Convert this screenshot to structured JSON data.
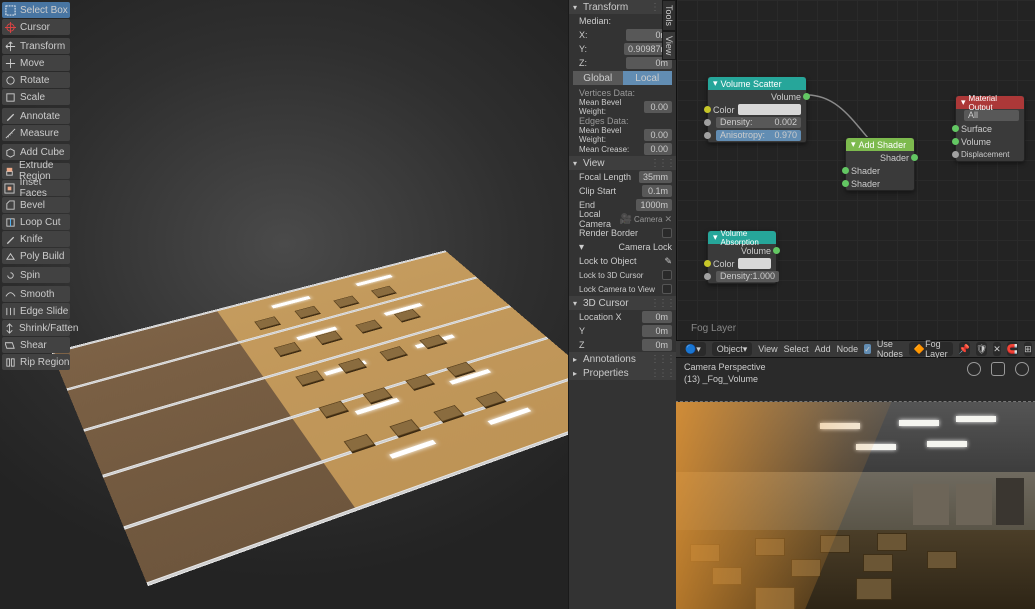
{
  "toolbox": {
    "groups": [
      [
        {
          "name": "select-box",
          "label": "Select Box",
          "selected": true
        },
        {
          "name": "cursor",
          "label": "Cursor"
        }
      ],
      [
        {
          "name": "transform",
          "label": "Transform"
        },
        {
          "name": "move",
          "label": "Move"
        },
        {
          "name": "rotate",
          "label": "Rotate"
        },
        {
          "name": "scale",
          "label": "Scale"
        }
      ],
      [
        {
          "name": "annotate",
          "label": "Annotate"
        },
        {
          "name": "measure",
          "label": "Measure"
        }
      ],
      [
        {
          "name": "add-cube",
          "label": "Add Cube"
        }
      ],
      [
        {
          "name": "extrude-region",
          "label": "Extrude Region"
        },
        {
          "name": "inset-faces",
          "label": "Inset Faces"
        },
        {
          "name": "bevel",
          "label": "Bevel"
        },
        {
          "name": "loop-cut",
          "label": "Loop Cut"
        },
        {
          "name": "knife",
          "label": "Knife"
        },
        {
          "name": "poly-build",
          "label": "Poly Build"
        }
      ],
      [
        {
          "name": "spin",
          "label": "Spin"
        }
      ],
      [
        {
          "name": "smooth",
          "label": "Smooth"
        },
        {
          "name": "edge-slide",
          "label": "Edge Slide"
        },
        {
          "name": "shrink-fatten",
          "label": "Shrink/Fatten"
        },
        {
          "name": "shear",
          "label": "Shear"
        },
        {
          "name": "rip-region",
          "label": "Rip Region"
        }
      ]
    ]
  },
  "npanel": {
    "transform": {
      "title": "Transform",
      "median_label": "Median:",
      "x_label": "X:",
      "x_value": "0m",
      "y_label": "Y:",
      "y_value": "0.90987m",
      "z_label": "Z:",
      "z_value": "0m",
      "space": {
        "global": "Global",
        "local": "Local",
        "active": "local"
      },
      "vertices_data_label": "Vertices Data:",
      "mean_bevel_weight_label": "Mean Bevel Weight:",
      "mean_bevel_weight_value": "0.00",
      "edges_data_label": "Edges Data:",
      "mean_bevel_weight2_label": "Mean Bevel Weight:",
      "mean_bevel_weight2_value": "0.00",
      "mean_crease_label": "Mean Crease:",
      "mean_crease_value": "0.00"
    },
    "view": {
      "title": "View",
      "focal_label": "Focal Length",
      "focal_value": "35mm",
      "clip_start_label": "Clip Start",
      "clip_start_value": "0.1m",
      "clip_end_label": "End",
      "clip_end_value": "1000m",
      "local_camera_label": "Local Camera",
      "local_camera_value": "Camera",
      "render_border_label": "Render Border",
      "camera_lock_title": "Camera Lock",
      "lock_object_label": "Lock to Object",
      "lock_3dcursor_label": "Lock to 3D Cursor",
      "lock_cam_view_label": "Lock Camera to View"
    },
    "cursor3d": {
      "title": "3D Cursor",
      "loc_x_label": "Location X",
      "loc_x_value": "0m",
      "loc_y_label": "Y",
      "loc_y_value": "0m",
      "loc_z_label": "Z",
      "loc_z_value": "0m"
    },
    "annotations": {
      "title": "Annotations"
    },
    "properties": {
      "title": "Properties"
    },
    "tabs": {
      "tools": "Tools",
      "view": "View"
    }
  },
  "node_editor": {
    "label": "Fog Layer",
    "header": {
      "editor_type": "Shader",
      "mode": "Object",
      "menus": [
        "View",
        "Select",
        "Add",
        "Node"
      ],
      "use_nodes_label": "Use Nodes",
      "material": "Fog Layer"
    },
    "nodes": {
      "scatter": {
        "title": "Volume Scatter",
        "out": "Volume",
        "color_label": "Color",
        "density_label": "Density:",
        "density_value": "0.002",
        "aniso_label": "Anisotropy:",
        "aniso_value": "0.970"
      },
      "absorb": {
        "title": "Volume Absorption",
        "out": "Volume",
        "color_label": "Color",
        "density_label": "Density:",
        "density_value": "1.000"
      },
      "add": {
        "title": "Add Shader",
        "out": "Shader",
        "in1": "Shader",
        "in2": "Shader"
      },
      "output": {
        "title": "Material Output",
        "target": "All",
        "surface": "Surface",
        "volume": "Volume",
        "disp": "Displacement"
      }
    }
  },
  "vp2": {
    "line1": "Camera Perspective",
    "line2": "(13) _Fog_Volume"
  }
}
